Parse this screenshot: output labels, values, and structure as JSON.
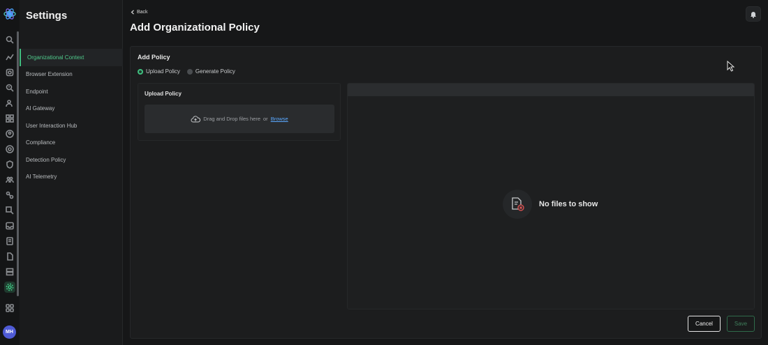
{
  "sidebar": {
    "title": "Settings",
    "items": [
      {
        "label": "Organizational Context"
      },
      {
        "label": "Browser Extension"
      },
      {
        "label": "Endpoint"
      },
      {
        "label": "AI Gateway"
      },
      {
        "label": "User Interaction Hub"
      },
      {
        "label": "Compliance"
      },
      {
        "label": "Detection Policy"
      },
      {
        "label": "AI Telemetry"
      }
    ]
  },
  "user": {
    "initials": "MH"
  },
  "header": {
    "back_label": "Back",
    "title": "Add Organizational Policy"
  },
  "card": {
    "title": "Add Policy",
    "radio_upload": "Upload Policy",
    "radio_generate": "Generate Policy",
    "upload_title": "Upload Policy",
    "drop_text": "Drag and Drop files here",
    "or_text": "or",
    "browse_label": "Browse",
    "empty_text": "No files to show"
  },
  "buttons": {
    "cancel": "Cancel",
    "save": "Save"
  },
  "colors": {
    "accent": "#3fbf7f",
    "link": "#5aa8ff",
    "background": "#161718"
  }
}
